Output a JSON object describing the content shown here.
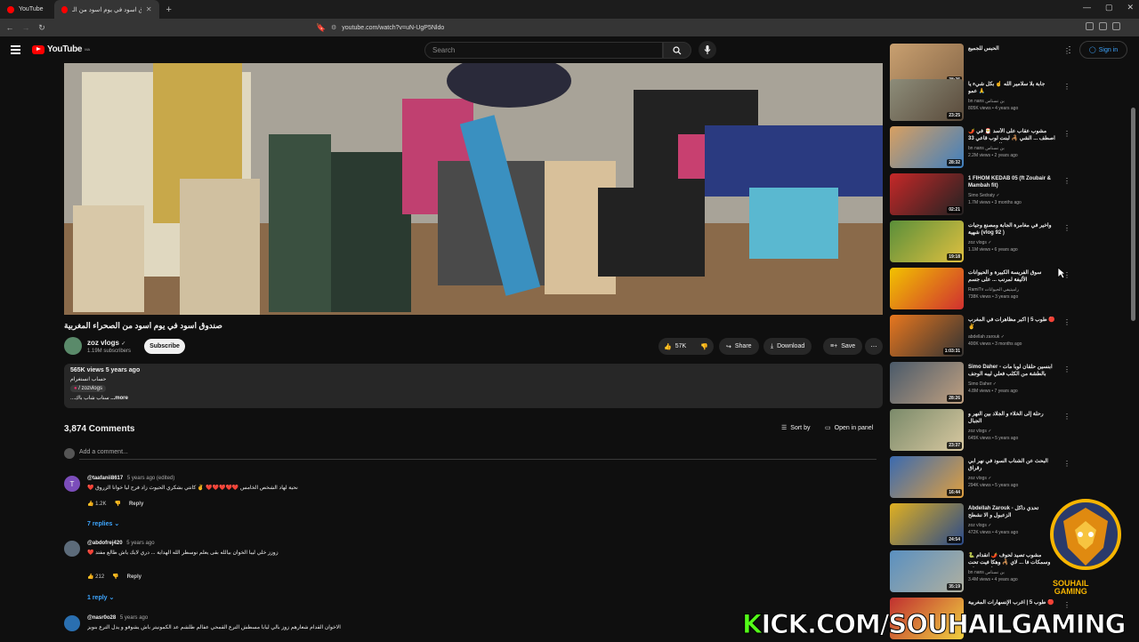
{
  "browser": {
    "tabs": [
      {
        "title": "YouTube",
        "active": false
      },
      {
        "title": "صندوق اسود في يوم اسود من الـ",
        "active": true
      }
    ],
    "url": "youtube.com/watch?v=uN-UgP5Nldo",
    "window_controls": [
      "—",
      "▢",
      "✕"
    ]
  },
  "header": {
    "logo_text": "YouTube",
    "logo_badge": "MA",
    "search_placeholder": "Search",
    "sign_in": "Sign in"
  },
  "video": {
    "title": "صندوق اسود في يوم اسود من الصحراء المغربية",
    "channel": "zoz vlogs",
    "subscribers": "1.19M subscribers",
    "subscribe_label": "Subscribe",
    "likes": "57K",
    "share_label": "Share",
    "download_label": "Download",
    "save_label": "Save",
    "description": {
      "stats": "565K views  5 years ago",
      "line1": "حساب انستغرام",
      "handle": "/ zozvlogs",
      "line3": "...سناب شاب باك",
      "more": "...more"
    }
  },
  "comments": {
    "count_label": "3,874 Comments",
    "sort_label": "Sort by",
    "open_panel_label": "Open in panel",
    "add_placeholder": "Add a comment...",
    "items": [
      {
        "author": "@taafanii8617",
        "time": "5 years ago (edited)",
        "text": "❤️ نحية لهاد الشخص الخامس ❤️❤️❤️❤️❤️ ✌️ كانتي بشكري الحيوث زاد فرح ليا خوانا الزروق",
        "likes": "1.2K",
        "reply": "Reply",
        "replies": "7 replies",
        "avatar_color": "#7b4dba",
        "avatar_letter": "T"
      },
      {
        "author": "@abdofrej420",
        "time": "5 years ago",
        "text": "❤️ زوزز خلي ليبا الخوان بيالله بقى يعلم نوسطر الله الهداية ... دري لايك ياش طالع مفتد",
        "likes": "212",
        "reply": "Reply",
        "replies": "1 reply",
        "avatar_color": "#5c6b7a",
        "avatar_letter": ""
      },
      {
        "author": "@nasr0o28",
        "time": "5 years ago",
        "text": "الاخوان القدام شعارهم زوز بالي ليابا مسطش الترع القمحي عفالم طلشم عد الكمونيتر باش يشوفو و يدل الترع بنويز",
        "likes": "",
        "reply": "",
        "replies": "",
        "avatar_color": "#2a6fb0",
        "avatar_letter": ""
      }
    ]
  },
  "recommendations": [
    {
      "title": "الحبس للجميع",
      "channel": "",
      "meta": "",
      "duration": "38:25",
      "colors": [
        "#c9a070",
        "#8a6a4a"
      ]
    },
    {
      "title": "جابة بلا سلامير الله ☝️ بكل شيء يا عمو 🙏",
      "channel": "bn nans بن نسناس",
      "meta": "805K views • 4 years ago",
      "duration": "23:25",
      "colors": [
        "#8d8d7a",
        "#5a4a3a"
      ]
    },
    {
      "title": "🌶️ مشوب عقاب على الأسد 🎅 في اصطف ... الشي 🦂 لبنت لوب قاعي 33 للمسنة هذه في",
      "channel": "bn nans بن نسناس",
      "meta": "2.2M views • 2 years ago",
      "duration": "28:32",
      "colors": [
        "#d9a060",
        "#3f7fbf"
      ]
    },
    {
      "title": "1 FIHOM KEDAB 05 (ft Zoubair & Mambah fit)",
      "channel": "Simo Sedraty ✓",
      "meta": "1.7M views • 3 months ago",
      "duration": "02:21",
      "colors": [
        "#c62828",
        "#222"
      ]
    },
    {
      "title": "واخير في مغامرة الجابة ومصنع وجيات شهية (vlog 92 )",
      "channel": "zoz vlogs ✓",
      "meta": "1.1M views • 6 years ago",
      "duration": "19:18",
      "colors": [
        "#5a8f3a",
        "#e0c040"
      ]
    },
    {
      "title": "سوق الفريسة الكبيرة و الحيوانات الأليفة لمرنب ... على جسم",
      "channel": "RamiTv راميتيفي الحيوانات",
      "meta": "738K views • 3 years ago",
      "duration": "",
      "colors": [
        "#f2c200",
        "#d03030"
      ]
    },
    {
      "title": "طوب 5 | اكبر مظاهرات في المغرب 🔴 ✌️",
      "channel": "abdellah zarouk ✓",
      "meta": "400K views • 3 months ago",
      "duration": "1:03:31",
      "colors": [
        "#e8771e",
        "#333"
      ]
    },
    {
      "title": "Simo Daher - ابنسين حلقان لوبا مات بالطشة من الكلب فعلي ليبه الوجف",
      "channel": "Simo Daher ✓",
      "meta": "4.8M views • 7 years ago",
      "duration": "28:26",
      "colors": [
        "#4a5a6a",
        "#c0a080"
      ]
    },
    {
      "title": "رحلة إلى الخلاء و الجلاد بين النهر و الجبال",
      "channel": "zoz vlogs ✓",
      "meta": "645K views • 5 years ago",
      "duration": "23:37",
      "colors": [
        "#7a8a6a",
        "#d8c8a0"
      ]
    },
    {
      "title": "البحث عن الشناب السود في نهر ابي رقراق",
      "channel": "zoz vlogs ✓",
      "meta": "294K views • 5 years ago",
      "duration": "16:44",
      "colors": [
        "#3a6ab0",
        "#e0a040"
      ]
    },
    {
      "title": "Abdellah Zarouk - تحدي داكل الزعبول و الا نشطح",
      "channel": "zoz vlogs ✓",
      "meta": "472K views • 4 years ago",
      "duration": "24:54",
      "colors": [
        "#e0b020",
        "#2a4a8a"
      ]
    },
    {
      "title": "مشوب تصيد لحوف 🌶️ انقدام 🐍 وسمكات فا ... لاي 🦂 وهكا فيت تحت لترض قتلية",
      "channel": "bn nans بن نسناس",
      "meta": "3.4M views • 4 years ago",
      "duration": "35:19",
      "colors": [
        "#5a90c0",
        "#b0b0a0"
      ]
    },
    {
      "title": "طوب 5 | اغرب الإنسهارات المغربية 🔴",
      "channel": "",
      "meta": "",
      "duration": "",
      "colors": [
        "#c03030",
        "#f0d040"
      ]
    }
  ],
  "overlay": {
    "stream_text_k": "K",
    "stream_text_rest": "ICK.COM/SOUHAILGAMING",
    "logo_line1": "SOUHAIL",
    "logo_line2": "GAMING"
  }
}
